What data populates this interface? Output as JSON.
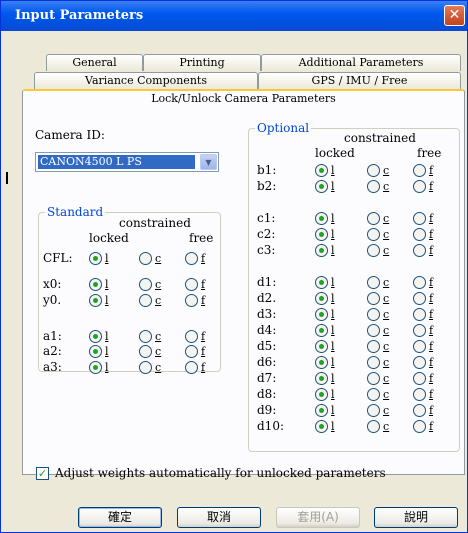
{
  "window": {
    "title": "Input Parameters",
    "close_icon": "close-icon"
  },
  "tabs": {
    "row1": [
      "General",
      "Printing",
      "Additional Parameters"
    ],
    "row2": [
      "Variance Components",
      "GPS / IMU / Free"
    ],
    "active": "Lock/Unlock Camera Parameters"
  },
  "camera": {
    "label": "Camera ID:",
    "selected": "CANON4500 L PS"
  },
  "headers": {
    "constrained": "constrained",
    "locked": "locked",
    "free": "free"
  },
  "standard": {
    "title": "Standard",
    "params": [
      {
        "name": "CFL:",
        "state": "l"
      },
      {
        "name": "x0:",
        "state": "l"
      },
      {
        "name": "y0.",
        "state": "l"
      },
      {
        "name": "a1:",
        "state": "l"
      },
      {
        "name": "a2:",
        "state": "l"
      },
      {
        "name": "a3:",
        "state": "l"
      }
    ]
  },
  "optional": {
    "title": "Optional",
    "params": [
      {
        "name": "b1:",
        "state": "l"
      },
      {
        "name": "b2:",
        "state": "l"
      },
      {
        "name": "c1:",
        "state": "l"
      },
      {
        "name": "c2:",
        "state": "l"
      },
      {
        "name": "c3:",
        "state": "l"
      },
      {
        "name": "d1:",
        "state": "l"
      },
      {
        "name": "d2.",
        "state": "l"
      },
      {
        "name": "d3:",
        "state": "l"
      },
      {
        "name": "d4:",
        "state": "l"
      },
      {
        "name": "d5:",
        "state": "l"
      },
      {
        "name": "d6:",
        "state": "l"
      },
      {
        "name": "d7:",
        "state": "l"
      },
      {
        "name": "d8:",
        "state": "l"
      },
      {
        "name": "d9:",
        "state": "l"
      },
      {
        "name": "d10:",
        "state": "l"
      }
    ]
  },
  "radio_letters": {
    "locked": "l",
    "constrained": "c",
    "free": "f"
  },
  "adjust": {
    "label": "Adjust weights automatically for unlocked parameters",
    "checked": true
  },
  "buttons": {
    "ok": "確定",
    "cancel": "取消",
    "apply": "套用(A)",
    "help": "說明"
  },
  "colors": {
    "title_bar": "#0058ee",
    "group_title": "#0046d5",
    "radio_dot": "#21a121",
    "tab_highlight": "#ffc83c"
  }
}
